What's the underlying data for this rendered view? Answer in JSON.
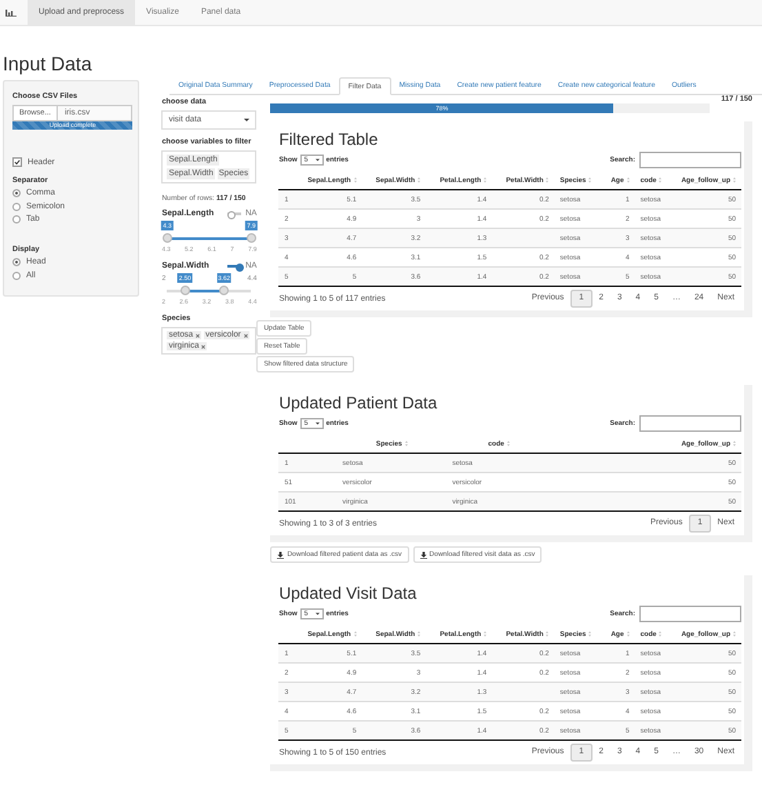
{
  "navbar": {
    "tabs": [
      {
        "label": "Upload and preprocess",
        "selected": true
      },
      {
        "label": "Visualize",
        "selected": false
      },
      {
        "label": "Panel data",
        "selected": false
      }
    ]
  },
  "page_title": "Input Data",
  "sidebar": {
    "file_label": "Choose CSV Files",
    "browse_button": "Browse...",
    "file_name": "iris.csv",
    "upload": {
      "label": "Upload complete",
      "level": 1
    },
    "header_checkbox": {
      "label": "Header",
      "checked": true
    },
    "groups": [
      {
        "label": "Separator",
        "options": [
          {
            "label": "Comma",
            "selected": true
          },
          {
            "label": "Semicolon",
            "selected": false
          },
          {
            "label": "Tab",
            "selected": false
          }
        ]
      },
      {
        "label": "Display",
        "options": [
          {
            "label": "Head",
            "selected": true
          },
          {
            "label": "All",
            "selected": false
          }
        ]
      }
    ]
  },
  "tabs": [
    {
      "label": "Original Data Summary",
      "selected": false
    },
    {
      "label": "Preprocessed Data",
      "selected": false
    },
    {
      "label": "Filter Data",
      "selected": true
    },
    {
      "label": "Missing Data",
      "selected": false
    },
    {
      "label": "Create new patient feature",
      "selected": false
    },
    {
      "label": "Create new categorical feature",
      "selected": false
    },
    {
      "label": "Outliers",
      "selected": false
    }
  ],
  "filter": {
    "data_label": "choose data",
    "data_value": "visit data",
    "variables_label": "choose variables to filter",
    "variables": [
      "Sepal.Length",
      "Sepal.Width",
      "Species"
    ],
    "rows_label": "Number of rows:",
    "rows_value": "117 / 150",
    "sliders": [
      {
        "name": "Sepal.Length",
        "na_label": "NA",
        "na_on": false,
        "from": {
          "label": "4.3",
          "level": 0
        },
        "to": {
          "label": "7.9",
          "level": 1
        },
        "ticks": [
          "4.3",
          "5.2",
          "6.1",
          "7",
          "7.9"
        ]
      },
      {
        "name": "Sepal.Width",
        "na_label": "NA",
        "na_on": true,
        "min": "2",
        "max": "4.4",
        "from": {
          "label": "2.50",
          "level": 0.21
        },
        "to": {
          "label": "3.62",
          "level": 0.675
        },
        "ticks": [
          "2",
          "2.6",
          "3.2",
          "3.8",
          "4.4"
        ]
      }
    ],
    "species": {
      "label": "Species",
      "tags": [
        "setosa",
        "versicolor",
        "virginica"
      ]
    }
  },
  "progress": {
    "label": "78%",
    "level": 0.78,
    "count": "117 / 150"
  },
  "main": [
    {
      "kind": "table",
      "title": "Filtered Table",
      "show_label": "Show",
      "length": "5",
      "entries_label": "entries",
      "search_label": "Search:",
      "columns": [
        {
          "name": "Sepal.Length",
          "numeric": true
        },
        {
          "name": "Sepal.Width",
          "numeric": true
        },
        {
          "name": "Petal.Length",
          "numeric": true
        },
        {
          "name": "Petal.Width",
          "numeric": true
        },
        {
          "name": "Species",
          "numeric": false
        },
        {
          "name": "Age",
          "numeric": true
        },
        {
          "name": "code",
          "numeric": false
        },
        {
          "name": "Age_follow_up",
          "numeric": true
        }
      ],
      "rows": [
        {
          "index": "1",
          "cells": [
            "5.1",
            "3.5",
            "1.4",
            "0.2",
            "setosa",
            "1",
            "setosa",
            "50"
          ]
        },
        {
          "index": "2",
          "cells": [
            "4.9",
            "3",
            "1.4",
            "0.2",
            "setosa",
            "2",
            "setosa",
            "50"
          ]
        },
        {
          "index": "3",
          "cells": [
            "4.7",
            "3.2",
            "1.3",
            null,
            "setosa",
            "3",
            "setosa",
            "50"
          ]
        },
        {
          "index": "4",
          "cells": [
            "4.6",
            "3.1",
            "1.5",
            "0.2",
            "setosa",
            "4",
            "setosa",
            "50"
          ]
        },
        {
          "index": "5",
          "cells": [
            "5",
            "3.6",
            "1.4",
            "0.2",
            "setosa",
            "5",
            "setosa",
            "50"
          ]
        }
      ],
      "info": "Showing 1 to 5 of 117 entries",
      "previous": "Previous",
      "next": "Next",
      "pages": [
        {
          "label": "1",
          "selected": true
        },
        {
          "label": "2",
          "selected": false
        },
        {
          "label": "3",
          "selected": false
        },
        {
          "label": "4",
          "selected": false
        },
        {
          "label": "5",
          "selected": false
        },
        {
          "label": "…",
          "selected": false
        },
        {
          "label": "24",
          "selected": false
        }
      ]
    },
    {
      "kind": "stacked_buttons",
      "buttons": [
        {
          "label": "Update Table"
        },
        {
          "label": "Reset Table"
        },
        {
          "label": "Show filtered data structure"
        }
      ]
    },
    {
      "kind": "table",
      "title": "Updated Patient Data",
      "show_label": "Show",
      "length": "5",
      "entries_label": "entries",
      "search_label": "Search:",
      "columns": [
        {
          "name": "Species",
          "numeric": false
        },
        {
          "name": "code",
          "numeric": false
        },
        {
          "name": "Age_follow_up",
          "numeric": true
        }
      ],
      "rows": [
        {
          "index": "1",
          "cells": [
            "setosa",
            "setosa",
            "50"
          ]
        },
        {
          "index": "51",
          "cells": [
            "versicolor",
            "versicolor",
            "50"
          ]
        },
        {
          "index": "101",
          "cells": [
            "virginica",
            "virginica",
            "50"
          ]
        }
      ],
      "info": "Showing 1 to 3 of 3 entries",
      "previous": "Previous",
      "next": "Next",
      "pages": [
        {
          "label": "1",
          "selected": true
        }
      ]
    },
    {
      "kind": "download_buttons",
      "buttons": [
        {
          "label": "Download filtered patient data as .csv"
        },
        {
          "label": "Download filtered visit data as .csv"
        }
      ]
    },
    {
      "kind": "table",
      "title": "Updated Visit Data",
      "show_label": "Show",
      "length": "5",
      "entries_label": "entries",
      "search_label": "Search:",
      "columns": [
        {
          "name": "Sepal.Length",
          "numeric": true
        },
        {
          "name": "Sepal.Width",
          "numeric": true
        },
        {
          "name": "Petal.Length",
          "numeric": true
        },
        {
          "name": "Petal.Width",
          "numeric": true
        },
        {
          "name": "Species",
          "numeric": false
        },
        {
          "name": "Age",
          "numeric": true
        },
        {
          "name": "code",
          "numeric": false
        },
        {
          "name": "Age_follow_up",
          "numeric": true
        }
      ],
      "rows": [
        {
          "index": "1",
          "cells": [
            "5.1",
            "3.5",
            "1.4",
            "0.2",
            "setosa",
            "1",
            "setosa",
            "50"
          ]
        },
        {
          "index": "2",
          "cells": [
            "4.9",
            "3",
            "1.4",
            "0.2",
            "setosa",
            "2",
            "setosa",
            "50"
          ]
        },
        {
          "index": "3",
          "cells": [
            "4.7",
            "3.2",
            "1.3",
            null,
            "setosa",
            "3",
            "setosa",
            "50"
          ]
        },
        {
          "index": "4",
          "cells": [
            "4.6",
            "3.1",
            "1.5",
            "0.2",
            "setosa",
            "4",
            "setosa",
            "50"
          ]
        },
        {
          "index": "5",
          "cells": [
            "5",
            "3.6",
            "1.4",
            "0.2",
            "setosa",
            "5",
            "setosa",
            "50"
          ]
        }
      ],
      "info": "Showing 1 to 5 of 150 entries",
      "previous": "Previous",
      "next": "Next",
      "pages": [
        {
          "label": "1",
          "selected": true
        },
        {
          "label": "2",
          "selected": false
        },
        {
          "label": "3",
          "selected": false
        },
        {
          "label": "4",
          "selected": false
        },
        {
          "label": "5",
          "selected": false
        },
        {
          "label": "…",
          "selected": false
        },
        {
          "label": "30",
          "selected": false
        }
      ]
    }
  ]
}
